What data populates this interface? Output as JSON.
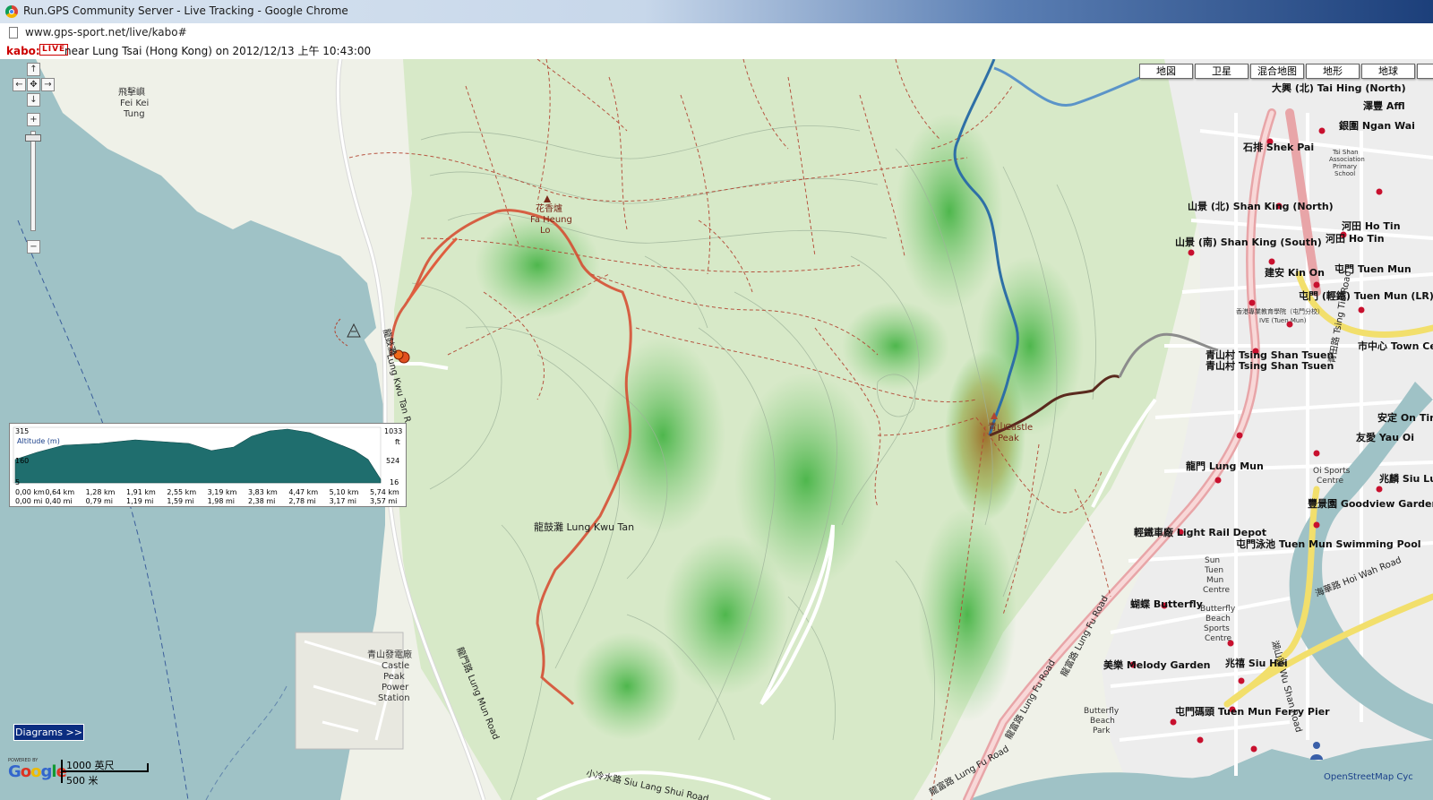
{
  "window": {
    "title": "Run.GPS Community Server - Live Tracking - Google Chrome",
    "url": "www.gps-sport.net/live/kabo#"
  },
  "status": {
    "user": "kabo:",
    "live_badge": "LIVE",
    "location_text": "near Lung Tsai (Hong Kong) on 2012/12/13 上午 10:43:00"
  },
  "map_types": [
    "地図",
    "卫星",
    "混合地图",
    "地形",
    "地球",
    "OSI"
  ],
  "nav": {
    "up": "↑",
    "left": "←",
    "center": "✥",
    "right": "→",
    "down": "↓",
    "zoom_in": "+",
    "zoom_out": "−"
  },
  "altitude_panel": {
    "title": "Altitude (m)",
    "y_left_labels": [
      "315",
      "160",
      "5"
    ],
    "y_right_labels": [
      "1033",
      "ft",
      "524",
      "16"
    ],
    "x_km_labels": [
      "0,00 km",
      "0,64 km",
      "1,28 km",
      "1,91 km",
      "2,55 km",
      "3,19 km",
      "3,83 km",
      "4,47 km",
      "5,10 km",
      "5,74 km"
    ],
    "x_mi_labels": [
      "0,00 mi",
      "0,40 mi",
      "0,79 mi",
      "1,19 mi",
      "1,59 mi",
      "1,98 mi",
      "2,38 mi",
      "2,78 mi",
      "3,17 mi",
      "3,57 mi"
    ],
    "fill_color": "#1f6e6e"
  },
  "diagrams_button": "Diagrams >>",
  "google_logo": {
    "powered": "POWERED BY",
    "word": "Google"
  },
  "scale": {
    "feet": "1000 英尺",
    "meters": "500 米"
  },
  "attribution": "OpenStreetMap Cyc",
  "map_labels": {
    "fei_kei": "飛擊嶼",
    "fei_kei_en1": "Fei Kei",
    "fei_kei_en2": "Tung",
    "fa_heung_cn": "花香爐",
    "fa_heung_en1": "Fa Heung",
    "fa_heung_en2": "Lo",
    "lung_kwu_tan": "龍鼓灘 Lung Kwu Tan",
    "lung_kwu_tan_rd": "Lung Kwu Tan R",
    "lung_kwu_tan_rd_cn": "龍鼓灘",
    "castle_peak_cn": "青山",
    "castle_peak_en1": "Castle",
    "castle_peak_en2": "Peak",
    "power_station_cn": "青山發電廠",
    "power_station_en1": "Castle",
    "power_station_en2": "Peak",
    "power_station_en3": "Power",
    "power_station_en4": "Station",
    "lung_mun_road": "龍門路 Lung Mun Road",
    "siu_lang_shui": "小冷水路 Siu Lang Shui Road",
    "lung_fu_road": "龍富路 Lung Fu Road",
    "lung_fu_road2": "龍富路 Lung Fu Road",
    "lung_fu_road3": "龍富路 Lung Fu Road",
    "tai_hing": "大興 (北) Tai Hing (North)",
    "ngan_wai": "銀圍 Ngan Wai",
    "affluence": "澤豐 Affl",
    "shek_pai": "石排 Shek Pai",
    "shan_king_n": "山景 (北) Shan King (North)",
    "shan_king_s": "山景 (南) Shan King (South)",
    "ho_tin": "河田 Ho Tin",
    "ho_tin2": "河田 Ho Tin",
    "kin_on": "建安 Kin On",
    "tuen_mun": "屯門 Tuen Mun",
    "tuen_mun_lr": "屯門 (輕鐵) Tuen Mun (LR)",
    "tsing_shan_tsuen": "青山村 Tsing Shan Tsuen",
    "tsing_shan_tsuen2": "青山村 Tsing Shan Tsuen",
    "town_centre": "市中心 Town Ce",
    "on_ting": "安定 On Tin",
    "yau_oi": "友愛 Yau Oi",
    "lung_mun": "龍門 Lung Mun",
    "siu_lun": "兆麟 Siu Lu",
    "goodview": "豐景園 Goodview Garden",
    "light_rail_depot": "輕鐵車廠 Light Rail Depot",
    "tm_swimming": "屯門泳池 Tuen Mun Swimming Pool",
    "butterfly": "蝴蝶 Butterfly",
    "melody_garden": "美樂 Melody Garden",
    "siu_hei": "兆禧 Siu Hei",
    "ferry_pier": "屯門碼頭 Tuen Mun Ferry Pier",
    "hoi_wah": "海華路 Hoi Wah Road",
    "wu_shan": "湖山路 Wu Shan Road",
    "tsing_tin": "青田路 Tsing Tin Road",
    "sun_tuen_mun1": "Sun",
    "sun_tuen_mun2": "Tuen",
    "sun_tuen_mun3": "Mun",
    "sun_tuen_mun4": "Centre",
    "butterfly_sports1": "Butterfly",
    "butterfly_sports2": "Beach",
    "butterfly_sports3": "Sports",
    "butterfly_sports4": "Centre",
    "butterfly_beach1": "Butterfly",
    "butterfly_beach2": "Beach",
    "butterfly_beach3": "Park",
    "ive1": "香港專業教育學院（屯門分校）",
    "ive2": "IVE (Tuen Mun)",
    "tsing_shan_school1": "Tsi Shan",
    "tsing_shan_school2": "Association",
    "tsing_shan_school3": "Primary",
    "tsing_shan_school4": "School",
    "oi_sports1": "Oi Sports",
    "oi_sports2": "Centre"
  },
  "colors": {
    "water": "#9fc2c6",
    "land": "#eef0e6",
    "track_red": "#d6472b",
    "track_blue": "#2e6fa6",
    "track_dark": "#5a2a1e",
    "track_gray": "#8c8c8c",
    "road_pink": "#e8a5a8"
  }
}
